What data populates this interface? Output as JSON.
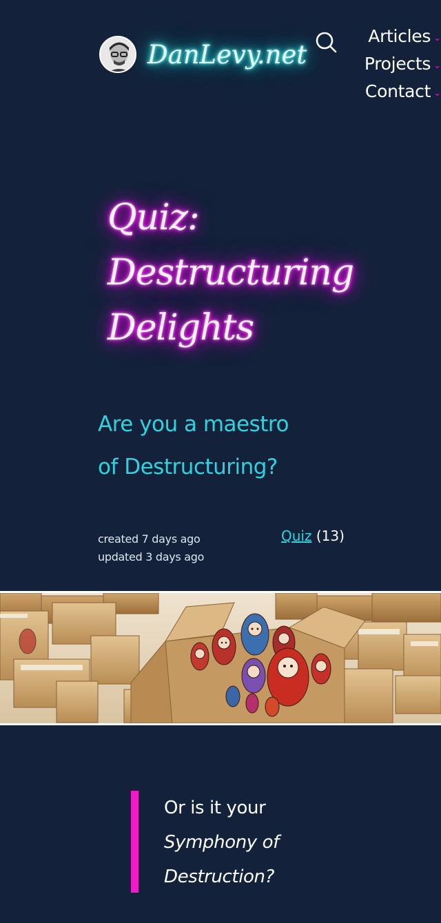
{
  "site": {
    "name": "DanLevy.net",
    "avatar_icon": "avatar-photo"
  },
  "nav": {
    "search_icon": "search-icon",
    "items": [
      {
        "label": "Articles"
      },
      {
        "label": "Projects"
      },
      {
        "label": "Contact"
      }
    ],
    "caret_glyph": "⌄"
  },
  "post": {
    "title_lines": [
      "Quiz:",
      "Destructuring",
      "Delights"
    ],
    "subtitle_lines": [
      "Are you a maestro",
      "of Destructuring?"
    ],
    "created": "created 7 days ago",
    "updated": "updated 3 days ago",
    "tag": {
      "label": "Quiz",
      "count": "(13)"
    },
    "hero_alt": "cardboard boxes with nesting dolls",
    "quote": {
      "line1": "Or is it your",
      "line2": "Symphony of",
      "line3": "Destruction?"
    }
  },
  "colors": {
    "background": "#13223a",
    "neon_cyan": "#2ed3e0",
    "neon_magenta": "#ee1bc7",
    "text": "#ffffff"
  }
}
